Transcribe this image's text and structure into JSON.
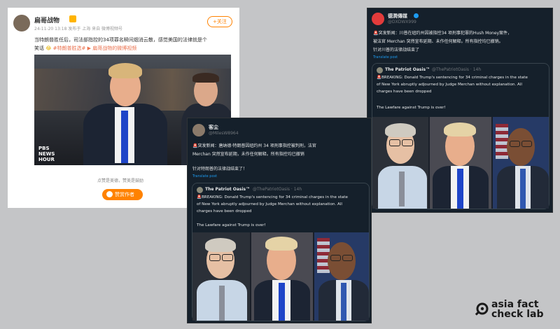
{
  "weibo": {
    "username": "扁哥战物",
    "time_source": "24-11-20 13:18  发布于 上海  来自 微博视频号",
    "follow_label": "+关注",
    "body_line1": "当特朗普胜任后，司法部指控的34项罪名瞬间烟消云散，感觉美国的法律就是个",
    "body_line2_prefix": "笑话",
    "hashtag": "#特朗普胜选#",
    "video_link": "扁哥战物的微博视频",
    "watermark": "PBS NEWS HOUR",
    "like_prompt": "点赞是美德，赞美是鼓励",
    "support_button": "赞赏作者"
  },
  "tweet_right": {
    "display_name": "德潤傳媒",
    "handle": "@DXDWX999",
    "body": "🚨突发新闻：川普在纽约州因被指控34 项刑事犯罪的Hush Money案件，被法官 Merchan 突然宣布延期、未作任何解释。所有指控均已撤销。",
    "body_lines": [
      "🚨突发新闻：川普在纽约州因被指控34 项刑事犯罪的Hush Money案件，",
      "被法官 Merchan 突然宣布延期、未作任何解释。所有指控均已撤销。",
      "针对川普的法律战结束了"
    ],
    "translate": "Translate post",
    "quote": {
      "name": "The Patriot Oasis™",
      "handle": "@ThePatriotOasis · 14h",
      "lines": [
        "🚨BREAKING: Donald Trump's sentencing for 34 criminal charges in the state",
        "of New York abruptly adjourned by Judge Merchan without explanation. All",
        "charges have been dropped"
      ],
      "closing": "The Lawfare against Trump is over!"
    }
  },
  "tweet_mid": {
    "display_name": "客尘",
    "handle": "@MilesW8964",
    "body_lines": [
      "🚨突发新闻：唐纳德·特朗普因纽约州 34 项刑事指控被判刑，法官",
      "Merchan 突然宣布延期，未作任何解释。所有指控均已撤销"
    ],
    "closing": "针对特朗普的法律战结束了！",
    "translate": "Translate post",
    "quote": {
      "name": "The Patriot Oasis™",
      "handle": "@ThePatriotOasis · 14h",
      "lines": [
        "🚨BREAKING: Donald Trump's sentencing for 34 criminal charges in the state",
        "of New York abruptly adjourned by Judge Merchan without explanation. All",
        "charges have been dropped"
      ],
      "closing": "The Lawfare against Trump is over!"
    }
  },
  "logo": {
    "line1": "asia fact",
    "line2": "check lab"
  },
  "colors": {
    "background": "#c4c5c7",
    "twitter_bg": "#15202b",
    "twitter_link": "#1d9bf0",
    "weibo_link": "#eb7350",
    "weibo_orange": "#ff8200"
  },
  "icons": [
    "verified-badge-icon",
    "tiktok-like-logo-icon",
    "heart-icon",
    "play-icon"
  ]
}
